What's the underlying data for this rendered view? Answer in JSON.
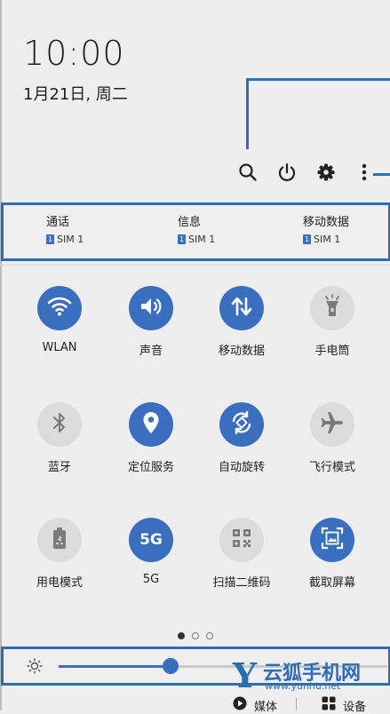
{
  "status": {
    "time": "10:00",
    "date": "1月21日, 周二"
  },
  "toolbar": [
    {
      "icon": "search-icon"
    },
    {
      "icon": "power-icon"
    },
    {
      "icon": "settings-icon"
    },
    {
      "icon": "more-icon"
    }
  ],
  "sim_prefs": [
    {
      "title": "通话",
      "sim": "SIM 1",
      "badge": "1"
    },
    {
      "title": "信息",
      "sim": "SIM 1",
      "badge": "1"
    },
    {
      "title": "移动数据",
      "sim": "SIM 1",
      "badge": "1"
    }
  ],
  "tiles": [
    {
      "label": "WLAN",
      "icon": "wifi-icon",
      "active": true
    },
    {
      "label": "声音",
      "icon": "sound-icon",
      "active": true
    },
    {
      "label": "移动数据",
      "icon": "mobile-data-icon",
      "active": true
    },
    {
      "label": "手电筒",
      "icon": "flashlight-icon",
      "active": false
    },
    {
      "label": "蓝牙",
      "icon": "bluetooth-icon",
      "active": false
    },
    {
      "label": "定位服务",
      "icon": "location-icon",
      "active": true
    },
    {
      "label": "自动旋转",
      "icon": "auto-rotate-icon",
      "active": true
    },
    {
      "label": "飞行模式",
      "icon": "airplane-icon",
      "active": false
    },
    {
      "label": "用电模式",
      "icon": "battery-mode-icon",
      "active": false
    },
    {
      "label": "5G",
      "icon": "5g-icon",
      "icon_text": "5G",
      "active": true
    },
    {
      "label": "扫描二维码",
      "icon": "qr-code-icon",
      "active": false
    },
    {
      "label": "截取屏幕",
      "icon": "screenshot-icon",
      "active": true
    }
  ],
  "pager": {
    "pages": 3,
    "current": 1
  },
  "brightness": {
    "level": 0.34
  },
  "bottom": {
    "media_label": "媒体",
    "devices_label": "设备"
  },
  "watermark": {
    "letter": "Y",
    "title": "云狐手机网",
    "url": "www.yunhu.net"
  },
  "colors": {
    "accent": "#3a6fc0",
    "annotation": "#2f6db3",
    "tile_off": "#dcdcdc",
    "background": "#eeeeee"
  }
}
